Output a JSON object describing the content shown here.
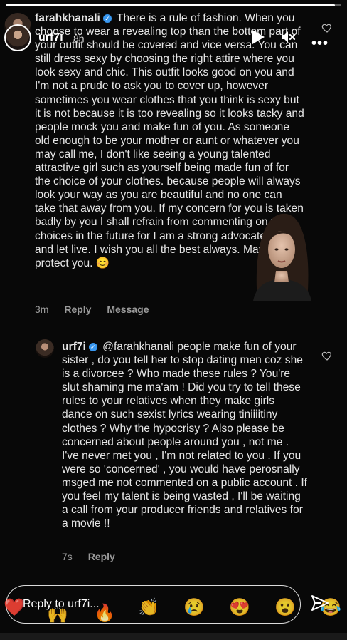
{
  "story": {
    "username": "urf7i",
    "time": "8h",
    "progress": 0.98
  },
  "comment1": {
    "username": "farahkhanali",
    "text": "There is a rule of fashion.  When you choose to wear a revealing top than the bottom part of your outfit should be covered and vice versa. You can still dress sexy by choosing the right attire where you look sexy and chic. This outfit looks good on you and I'm not a prude to ask you to cover up, however sometimes you wear clothes that you think is sexy but it is not because it is too revealing so it looks tacky and people mock you and make fun of you. As someone old enough to be your mother or aunt or whatever you may call me, I don't like seeing a young talented attractive girl such as yourself being made fun of for the choice of your clothes. because people will always look your way as you are beautiful and no one can take that away from you. If my concern for you is taken badly by you I shall refrain from commenting on your choices in the future for I am a strong advocate of live and let live. I wish you all the best always. May God protect you. 😊",
    "time": "3m",
    "reply_label": "Reply",
    "message_label": "Message"
  },
  "comment2": {
    "username": "urf7i",
    "text": "@farahkhanali people make fun of your sister , do you tell her to stop dating men coz she is a divorcee ? Who made these rules ? You're slut shaming me ma'am ! Did you try to tell these rules to your relatives when they make girls dance on such sexist lyrics wearing tiniiiitiny clothes ? Why the hypocrisy ? Also please be concerned about people around you , not me .  I've never met you , I'm not related to you . If you were so 'concerned' , you would have perosnally msged me not commented on a public account . If you feel my talent is being wasted , I'll be waiting a call from your producer friends and relatives  for a movie !!",
    "time": "7s",
    "reply_label": "Reply"
  },
  "reply_bar": {
    "placeholder": "Reply to urf7i...",
    "reactions": [
      "❤️",
      "🙌",
      "🔥",
      "👏",
      "😢",
      "😍",
      "😮",
      "😂"
    ]
  },
  "icons": {
    "verified": "verified-badge-icon",
    "play": "play-icon",
    "mute": "mute-icon",
    "more": "more-options-icon",
    "heart": "heart-outline-icon",
    "send": "send-icon"
  },
  "colors": {
    "verified_blue": "#3897f0",
    "background": "#080808",
    "muted_text": "#9a9a9a"
  }
}
